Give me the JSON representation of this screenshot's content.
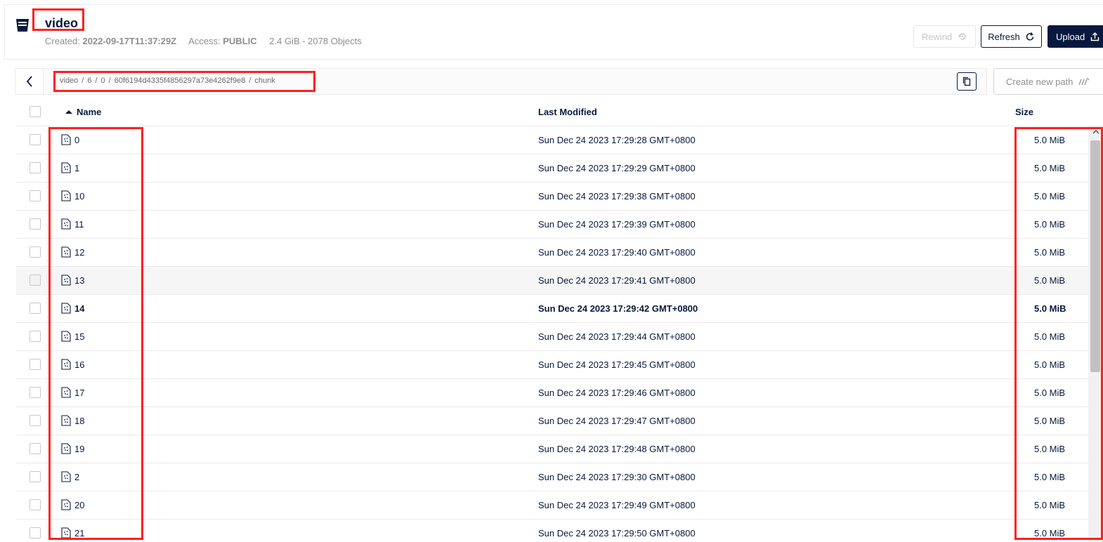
{
  "bucket": {
    "name": "video",
    "created_label": "Created:",
    "created_value": "2022-09-17T11:37:29Z",
    "access_label": "Access:",
    "access_value": "PUBLIC",
    "usage": "2.4 GiB - 2078 Objects"
  },
  "toolbar": {
    "rewind_label": "Rewind",
    "refresh_label": "Refresh",
    "upload_label": "Upload"
  },
  "path": {
    "segments": [
      "video",
      "6",
      "0",
      "60f6194d4335f4856297a73e4262f9e8",
      "chunk"
    ],
    "separator": "/",
    "create_new_path_label": "Create new path"
  },
  "table": {
    "columns": {
      "name": "Name",
      "last_modified": "Last Modified",
      "size": "Size"
    },
    "rows": [
      {
        "name": "0",
        "modified": "Sun Dec 24 2023 17:29:28 GMT+0800",
        "size": "5.0 MiB"
      },
      {
        "name": "1",
        "modified": "Sun Dec 24 2023 17:29:29 GMT+0800",
        "size": "5.0 MiB"
      },
      {
        "name": "10",
        "modified": "Sun Dec 24 2023 17:29:38 GMT+0800",
        "size": "5.0 MiB"
      },
      {
        "name": "11",
        "modified": "Sun Dec 24 2023 17:29:39 GMT+0800",
        "size": "5.0 MiB"
      },
      {
        "name": "12",
        "modified": "Sun Dec 24 2023 17:29:40 GMT+0800",
        "size": "5.0 MiB"
      },
      {
        "name": "13",
        "modified": "Sun Dec 24 2023 17:29:41 GMT+0800",
        "size": "5.0 MiB"
      },
      {
        "name": "14",
        "modified": "Sun Dec 24 2023 17:29:42 GMT+0800",
        "size": "5.0 MiB"
      },
      {
        "name": "15",
        "modified": "Sun Dec 24 2023 17:29:44 GMT+0800",
        "size": "5.0 MiB"
      },
      {
        "name": "16",
        "modified": "Sun Dec 24 2023 17:29:45 GMT+0800",
        "size": "5.0 MiB"
      },
      {
        "name": "17",
        "modified": "Sun Dec 24 2023 17:29:46 GMT+0800",
        "size": "5.0 MiB"
      },
      {
        "name": "18",
        "modified": "Sun Dec 24 2023 17:29:47 GMT+0800",
        "size": "5.0 MiB"
      },
      {
        "name": "19",
        "modified": "Sun Dec 24 2023 17:29:48 GMT+0800",
        "size": "5.0 MiB"
      },
      {
        "name": "2",
        "modified": "Sun Dec 24 2023 17:29:30 GMT+0800",
        "size": "5.0 MiB"
      },
      {
        "name": "20",
        "modified": "Sun Dec 24 2023 17:29:49 GMT+0800",
        "size": "5.0 MiB"
      },
      {
        "name": "21",
        "modified": "Sun Dec 24 2023 17:29:50 GMT+0800",
        "size": "5.0 MiB"
      }
    ]
  },
  "colors": {
    "primary": "#07193e",
    "highlight": "#ff1f1f",
    "muted": "#8e8e8e"
  }
}
